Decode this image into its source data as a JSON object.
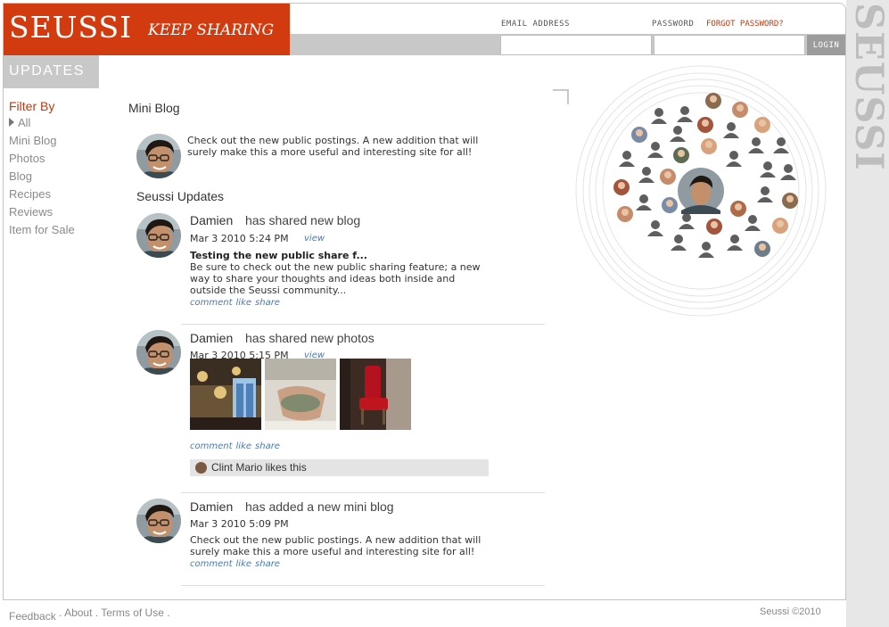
{
  "header": {
    "logo": "SEUSSI",
    "tagline": "KEEP SHARING",
    "email_label": "EMAIL ADDRESS",
    "password_label": "PASSWORD",
    "forgot_password": "FORGOT PASSWORD?",
    "login_button": "LOGIN",
    "email_value": "",
    "password_value": ""
  },
  "side_brand": "SEUSSI",
  "updates_tab": "UPDATES",
  "filter": {
    "title": "Filter By",
    "items": [
      "All",
      "Mini Blog",
      "Photos",
      "Blog",
      "Recipes",
      "Reviews",
      "Item for Sale"
    ]
  },
  "mini_blog": {
    "title": "Mini Blog",
    "text": "Check out the new public postings. A new addition that will surely make this a more useful and interesting site for all!"
  },
  "updates": {
    "title": "Seussi Updates",
    "items": [
      {
        "user": "Damien",
        "action": "has shared new blog",
        "time": "Mar 3 2010 5:24 PM",
        "view": "view",
        "post_title": "Testing the new public share f...",
        "post_body": "Be sure to check out the new public sharing feature; a new way to share your thoughts and ideas both inside and outside the Seussi community...",
        "actions": [
          "comment",
          "like",
          "share"
        ]
      },
      {
        "user": "Damien",
        "action": "has shared new photos",
        "time": "Mar 3 2010 5:15 PM",
        "view": "view",
        "actions": [
          "comment",
          "like",
          "share"
        ],
        "likes": "Clint Mario likes this"
      },
      {
        "user": "Damien",
        "action": "has added a new mini blog",
        "time": "Mar 3 2010 5:09 PM",
        "post_body": "Check out the new public postings. A new addition that will surely make this a more useful and interesting site for all!",
        "actions": [
          "comment",
          "like",
          "share"
        ]
      }
    ]
  },
  "footer": {
    "links": [
      "Feedback",
      "About",
      "Terms of Use"
    ],
    "copyright": "Seussi ©2010"
  },
  "colors": {
    "brand": "#d13b0f",
    "link": "#4a78b8",
    "filter_title": "#c03a0c",
    "bar_gray": "#c8c8c8"
  }
}
